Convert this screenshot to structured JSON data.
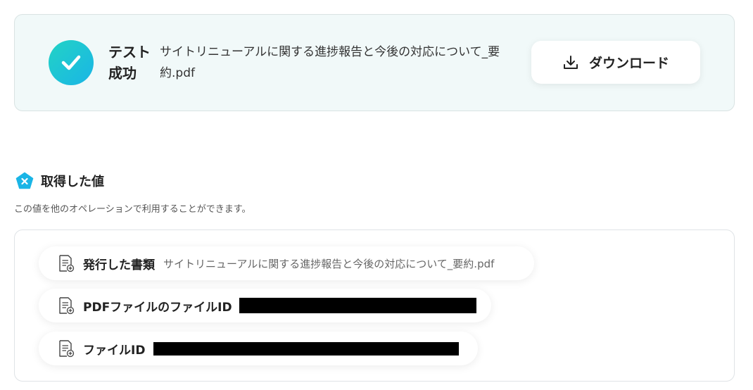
{
  "result": {
    "status_line1": "テスト",
    "status_line2": "成功",
    "file_title": "サイトリニューアルに関する進捗報告と今後の対応について_要約.pdf",
    "download_label": "ダウンロード",
    "accent_from": "#22d3c5",
    "accent_to": "#1ab5e6"
  },
  "section": {
    "title": "取得した値",
    "description": "この値を他のオペレーションで利用することができます。",
    "icon": "pentagon-x-icon",
    "icon_color": "#1ab5e6"
  },
  "values": [
    {
      "label": "発行した書類",
      "value": "サイトリニューアルに関する進捗報告と今後の対応について_要約.pdf",
      "icon": "document-plus-icon"
    },
    {
      "label": "PDFファイルのファイルID",
      "value": "",
      "redacted": true,
      "icon": "document-plus-icon"
    },
    {
      "label": "ファイルID",
      "value": "",
      "redacted": true,
      "icon": "document-plus-icon"
    }
  ]
}
